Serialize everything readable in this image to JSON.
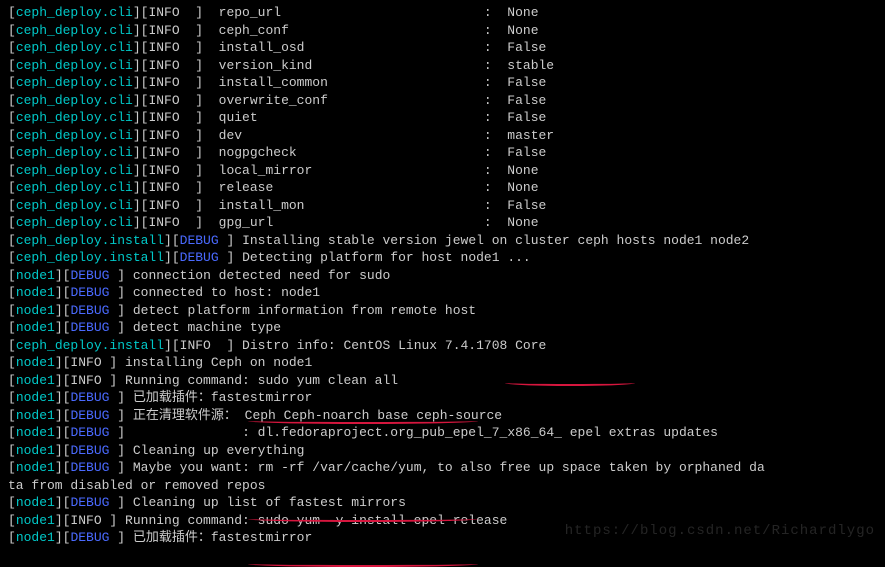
{
  "cfg": [
    {
      "k": "repo_url",
      "v": "None"
    },
    {
      "k": "ceph_conf",
      "v": "None"
    },
    {
      "k": "install_osd",
      "v": "False"
    },
    {
      "k": "version_kind",
      "v": "stable"
    },
    {
      "k": "install_common",
      "v": "False"
    },
    {
      "k": "overwrite_conf",
      "v": "False"
    },
    {
      "k": "quiet",
      "v": "False"
    },
    {
      "k": "dev",
      "v": "master"
    },
    {
      "k": "nogpgcheck",
      "v": "False"
    },
    {
      "k": "local_mirror",
      "v": "None"
    },
    {
      "k": "release",
      "v": "None"
    },
    {
      "k": "install_mon",
      "v": "False"
    },
    {
      "k": "gpg_url",
      "v": "None"
    }
  ],
  "install": {
    "debug1": "Installing stable version jewel on cluster ceph hosts node1 node2",
    "debug2": "Detecting platform for host node1 ..."
  },
  "node": [
    {
      "lvl": "DEBUG",
      "cls": "blue",
      "msg": "connection detected need for sudo"
    },
    {
      "lvl": "DEBUG",
      "cls": "blue",
      "msg": "connected to host: node1"
    },
    {
      "lvl": "DEBUG",
      "cls": "blue",
      "msg": "detect platform information from remote host"
    },
    {
      "lvl": "DEBUG",
      "cls": "blue",
      "msg": "detect machine type"
    }
  ],
  "distro": "Distro info: CentOS Linux 7.4.1708 Core",
  "post": [
    {
      "src": "node1",
      "lvl": "INFO",
      "cls": "",
      "msg": "installing Ceph on node1"
    },
    {
      "src": "node1",
      "lvl": "INFO",
      "cls": "",
      "msg": "Running command: sudo yum clean all"
    },
    {
      "src": "node1",
      "lvl": "DEBUG",
      "cls": "blue",
      "msg": "已加载插件：fastestmirror"
    },
    {
      "src": "node1",
      "lvl": "DEBUG",
      "cls": "blue",
      "msg": "正在清理软件源： Ceph Ceph-noarch base ceph-source"
    },
    {
      "src": "node1",
      "lvl": "DEBUG",
      "cls": "blue",
      "msg": "              : dl.fedoraproject.org_pub_epel_7_x86_64_ epel extras updates"
    },
    {
      "src": "node1",
      "lvl": "DEBUG",
      "cls": "blue",
      "msg": "Cleaning up everything"
    },
    {
      "src": "node1",
      "lvl": "DEBUG",
      "cls": "blue",
      "msg": "Maybe you want: rm -rf /var/cache/yum, to also free up space taken by orphaned da"
    }
  ],
  "wrap": "ta from disabled or removed repos",
  "tail": [
    {
      "src": "node1",
      "lvl": "DEBUG",
      "cls": "blue",
      "msg": "Cleaning up list of fastest mirrors"
    },
    {
      "src": "node1",
      "lvl": "INFO",
      "cls": "",
      "msg": "Running command: sudo yum -y install epel-release"
    },
    {
      "src": "node1",
      "lvl": "DEBUG",
      "cls": "blue",
      "msg": "已加载插件：fastestmirror"
    }
  ],
  "watermark": "https://blog.csdn.net/Richardlygo"
}
